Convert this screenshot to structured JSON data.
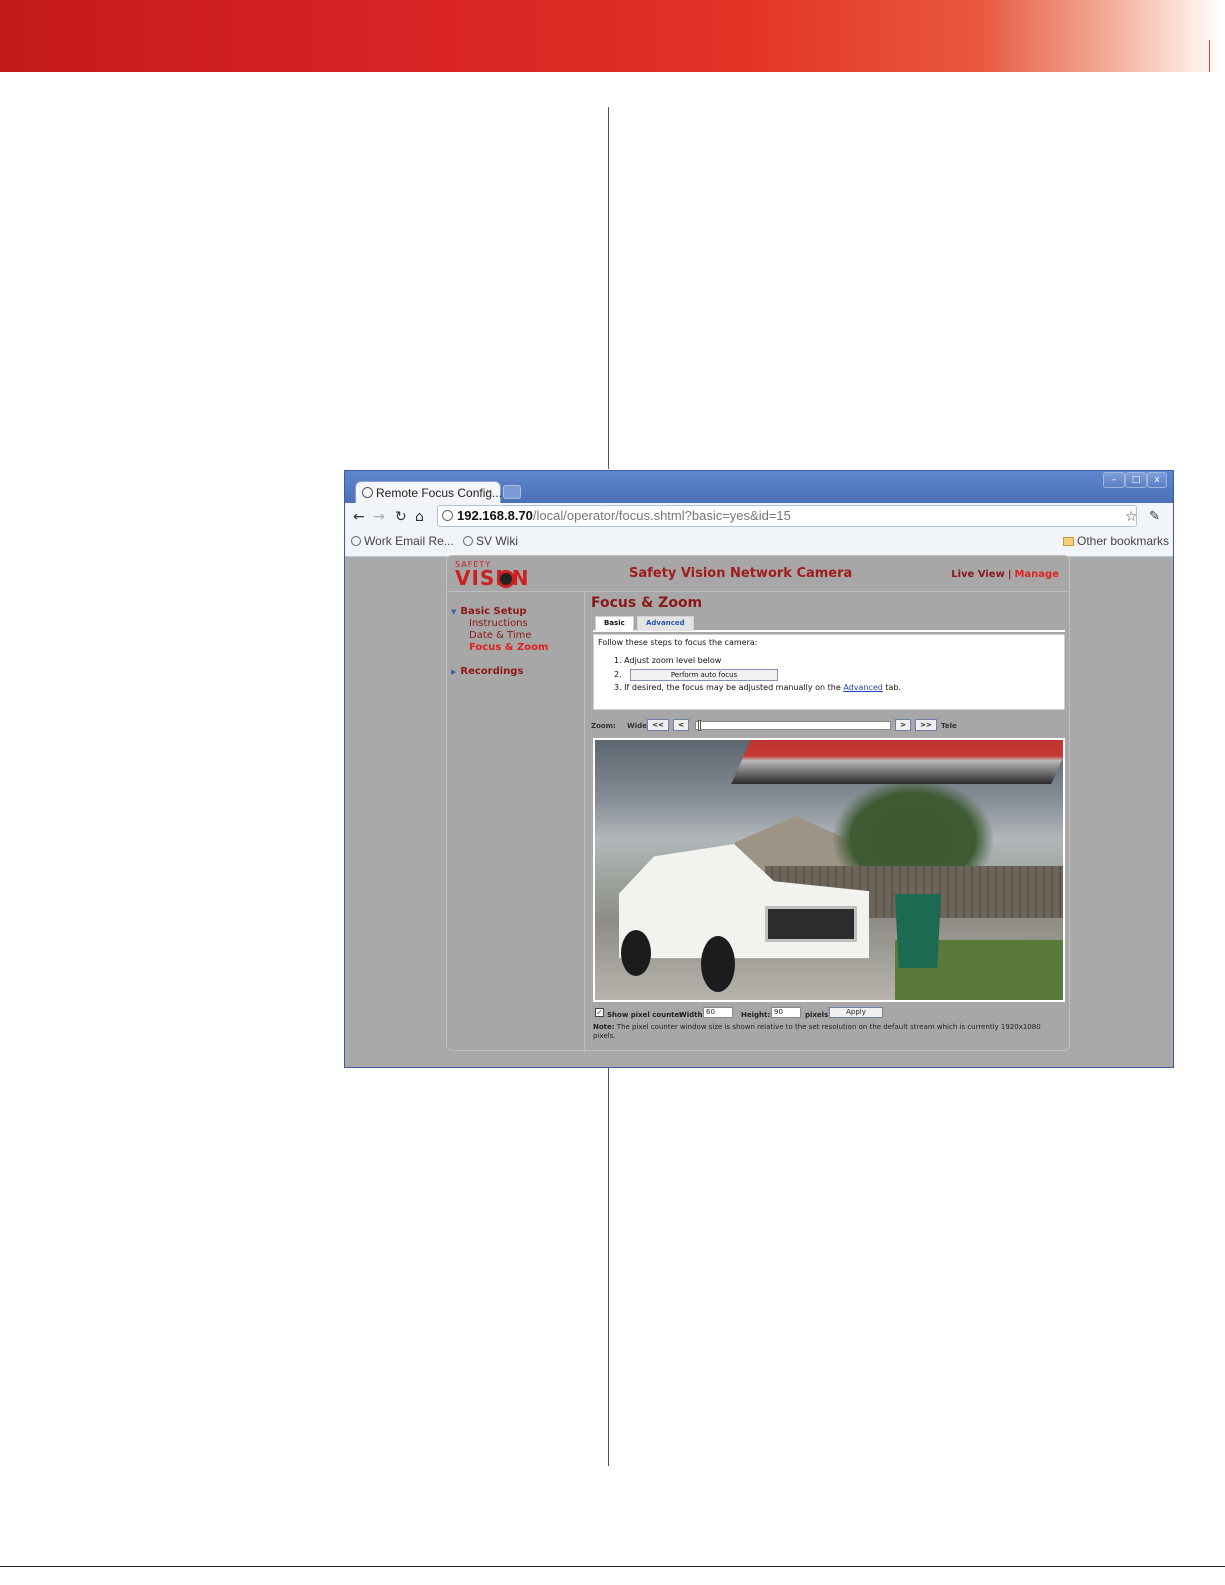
{
  "browser": {
    "tab_title": "Remote Focus Config...",
    "tab_close": "×",
    "url_host": "192.168.8.70",
    "url_path": "/local/operator/focus.shtml?basic=yes&id=15",
    "bookmarks": [
      {
        "label": "Work Email Re..."
      },
      {
        "label": "SV Wiki"
      }
    ],
    "other_bookmarks": "Other bookmarks",
    "window_controls": {
      "minimize": "–",
      "maximize": "□",
      "close": "x"
    }
  },
  "app": {
    "logo_small": "SAFETY",
    "logo_big": "VISI N",
    "title": "Safety Vision Network Camera",
    "link_live_view": "Live View",
    "link_separator": "|",
    "link_manage": "Manage",
    "sidebar": {
      "basic_setup": "Basic Setup",
      "items": [
        "Instructions",
        "Date & Time",
        "Focus & Zoom"
      ],
      "active": "Focus & Zoom",
      "recordings": "Recordings"
    },
    "heading": "Focus & Zoom",
    "tabs": [
      "Basic",
      "Advanced"
    ],
    "instructions": {
      "intro": "Follow these steps to focus the camera:",
      "step1": "1.  Adjust zoom level below",
      "step2": "2.",
      "autofocus_button": "Perform auto focus",
      "step3_prefix": "3.  If desired, the focus may be adjusted manually on the ",
      "step3_link": "Advanced",
      "step3_suffix": " tab."
    },
    "zoom": {
      "label": "Zoom:",
      "wide": "Wide",
      "btn_fast_back": "<<",
      "btn_back": "<",
      "btn_fwd": ">",
      "btn_fast_fwd": ">>",
      "tele": "Tele",
      "level_fraction": 0.01
    },
    "pixel_counter": {
      "checkbox_checked": true,
      "checkbox_label": "Show pixel counter",
      "width_label": "Width:",
      "width_value": "60",
      "height_label": "Height:",
      "height_value": "90",
      "unit": "pixels",
      "apply": "Apply"
    },
    "note_label": "Note:",
    "note_text": " The pixel counter window size is shown relative to the set resolution on the default stream which is currently 1920x1080 pixels."
  },
  "colors": {
    "brand_red": "#cc1f1f",
    "link_red": "#e02020",
    "link_blue": "#1f48b8"
  }
}
